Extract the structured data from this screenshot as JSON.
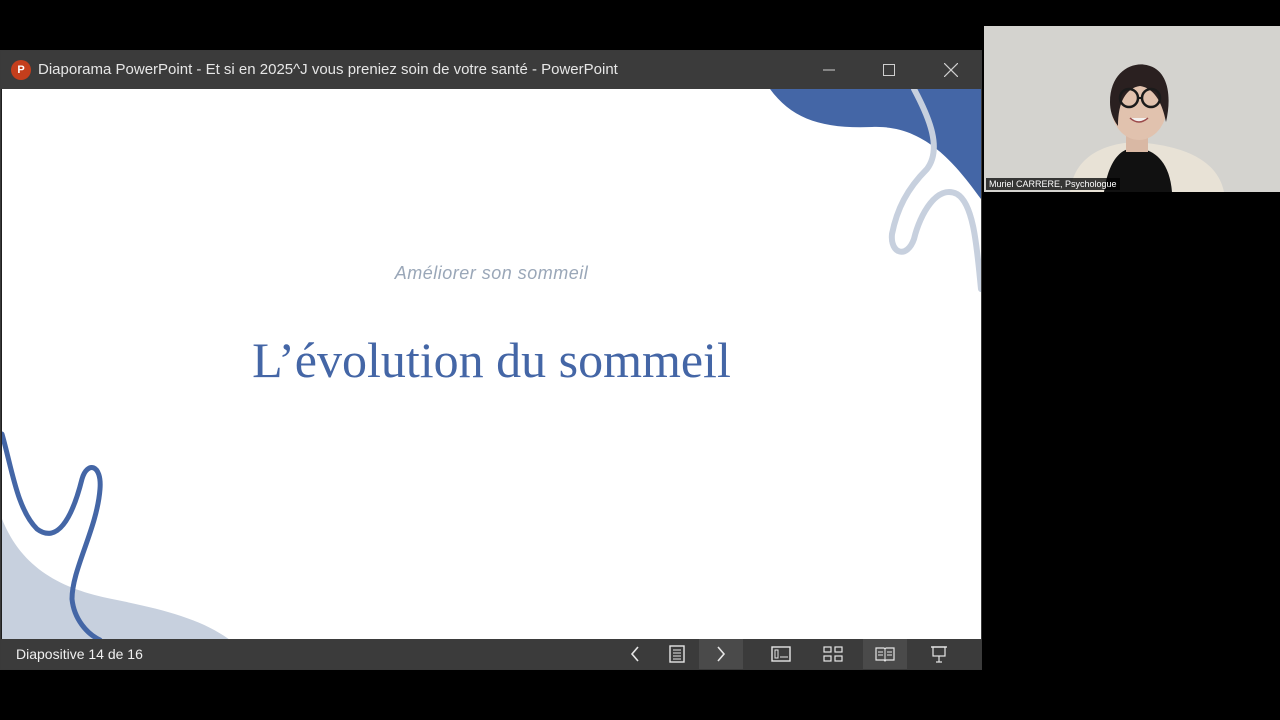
{
  "window": {
    "app_icon_letter": "P",
    "title": "Diaporama PowerPoint  -  Et si en 2025^J vous preniez soin de votre santé  - PowerPoint"
  },
  "slide": {
    "subtitle": "Améliorer son sommeil",
    "title": "L’évolution du sommeil"
  },
  "statusbar": {
    "counter": "Diapositive 14 de 16"
  },
  "webcam": {
    "participant_label": "Muriel CARRERE, Psychologue"
  },
  "colors": {
    "slide_title": "#4466a6",
    "slide_subtitle": "#9aa7b8",
    "accent_blue": "#4466a6",
    "accent_light": "#c7d0de",
    "ppt_icon": "#c43e1c"
  },
  "icons": [
    "powerpoint-icon",
    "minimize-icon",
    "maximize-icon",
    "close-icon",
    "chevron-left-icon",
    "notes-icon",
    "chevron-right-icon",
    "normal-view-icon",
    "slide-sorter-icon",
    "reading-view-icon",
    "slideshow-icon"
  ]
}
